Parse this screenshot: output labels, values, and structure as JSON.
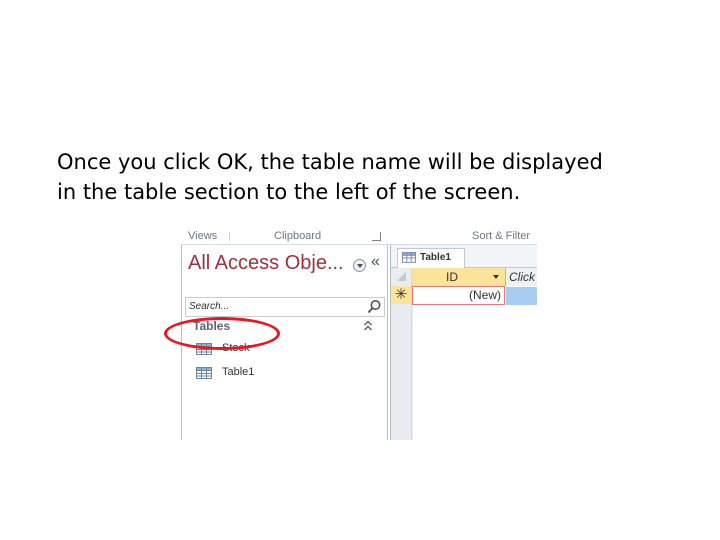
{
  "caption": {
    "line1": "Once you click OK, the table name will be displayed",
    "line2": "in the table section to the left of the screen."
  },
  "ribbon": {
    "views_label": "Views",
    "clipboard_label": "Clipboard",
    "sort_filter_label": "Sort & Filter"
  },
  "nav_pane": {
    "title": "All Access Obje...",
    "collapse_glyph": "«",
    "search": {
      "placeholder": "Search...",
      "value": ""
    },
    "group": {
      "label": "Tables",
      "collapse_glyph": "≈"
    },
    "items": [
      {
        "label": "Stock",
        "icon": "table-icon",
        "highlighted": true
      },
      {
        "label": "Table1",
        "icon": "table-icon",
        "highlighted": false
      }
    ]
  },
  "datasheet": {
    "tab_label": "Table1",
    "columns": [
      {
        "label": "ID",
        "has_dropdown": true
      },
      {
        "label": "Click"
      }
    ],
    "new_row": {
      "marker": "✳",
      "id_value": "(New)"
    }
  },
  "colors": {
    "nav_title": "#a2303a",
    "highlight_oval": "#e8171f",
    "selected_header": "#fbe39a",
    "selected_cell": "#a9cdf2"
  }
}
